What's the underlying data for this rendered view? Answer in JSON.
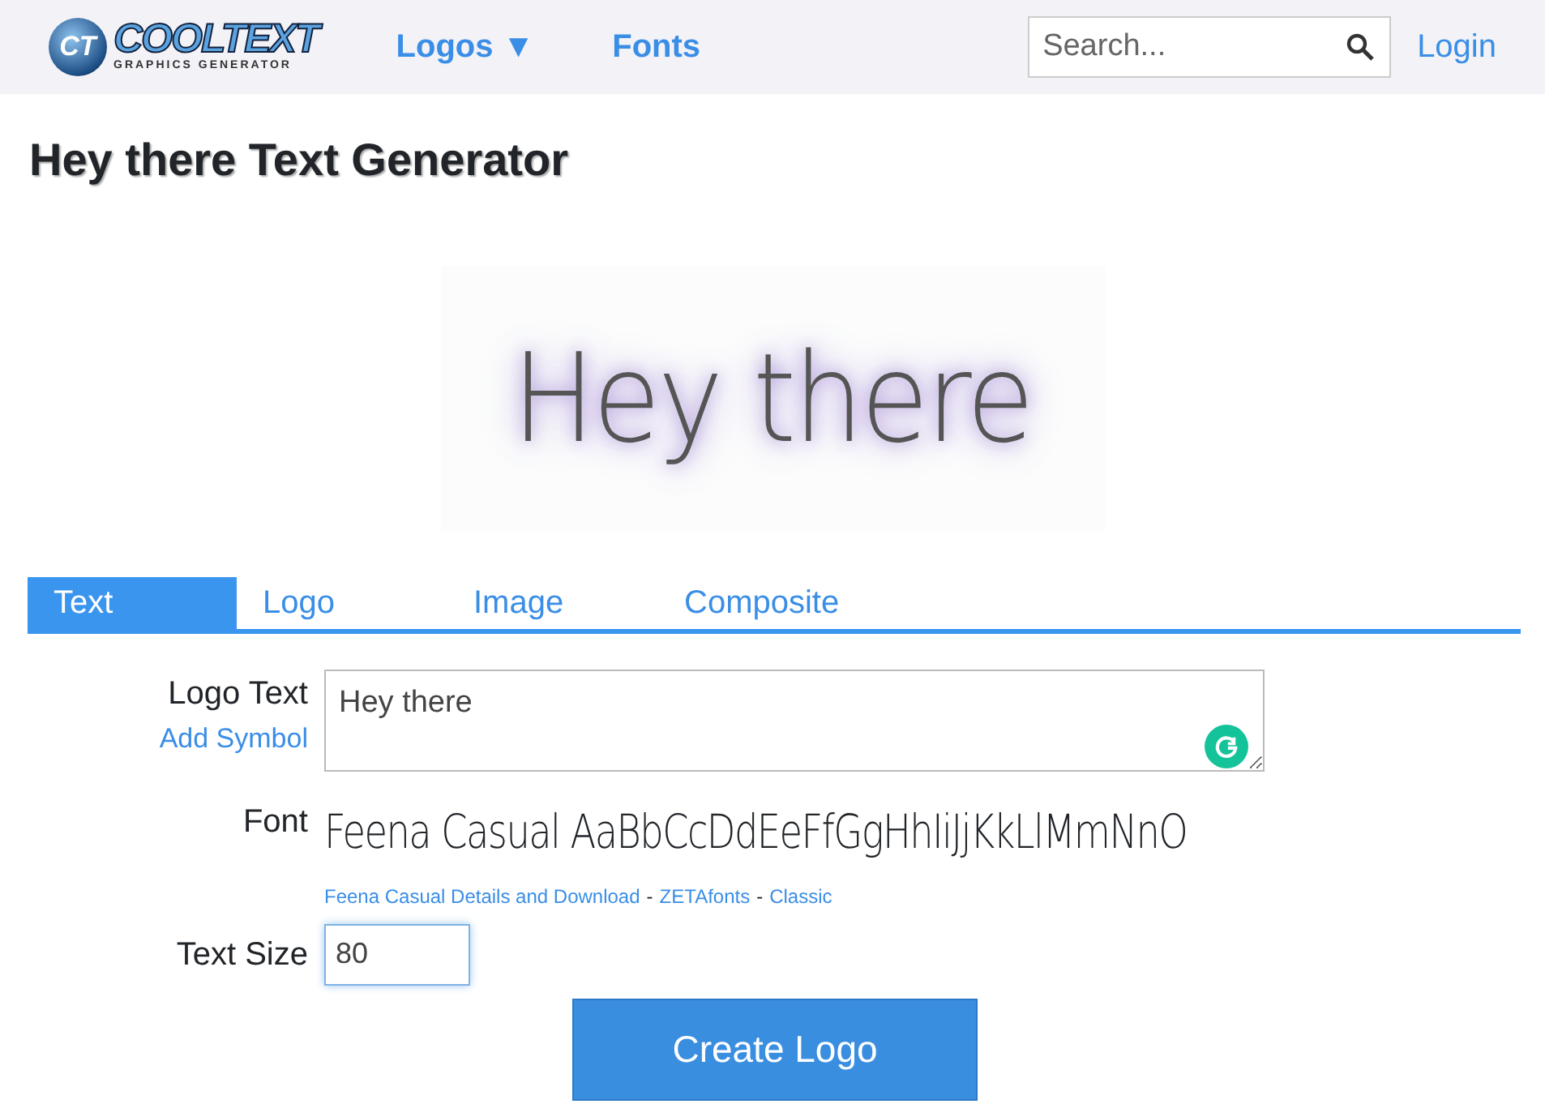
{
  "header": {
    "logo": {
      "mark": "CT",
      "title": "COOLTEXT",
      "subtitle": "GRAPHICS GENERATOR"
    },
    "nav": [
      {
        "label": "Logos",
        "caret": "▼"
      },
      {
        "label": "Fonts"
      }
    ],
    "search": {
      "placeholder": "Search..."
    },
    "login": "Login"
  },
  "page_title": "Hey there Text Generator",
  "preview": {
    "text": "Hey there"
  },
  "tabs": [
    {
      "label": "Text",
      "selected": true
    },
    {
      "label": "Logo",
      "selected": false
    },
    {
      "label": "Image",
      "selected": false
    },
    {
      "label": "Composite",
      "selected": false
    }
  ],
  "form": {
    "logo_text": {
      "label": "Logo Text",
      "link": "Add Symbol",
      "value": "Hey there"
    },
    "font": {
      "label": "Font",
      "sample": "Feena Casual AaBbCcDdEeFfGgHhIiJjKkLlMmNnO",
      "links": [
        "Feena Casual Details and Download",
        "ZETAfonts",
        "Classic"
      ],
      "separator": "-"
    },
    "text_size": {
      "label": "Text Size",
      "value": "80"
    },
    "submit": "Create Logo"
  }
}
